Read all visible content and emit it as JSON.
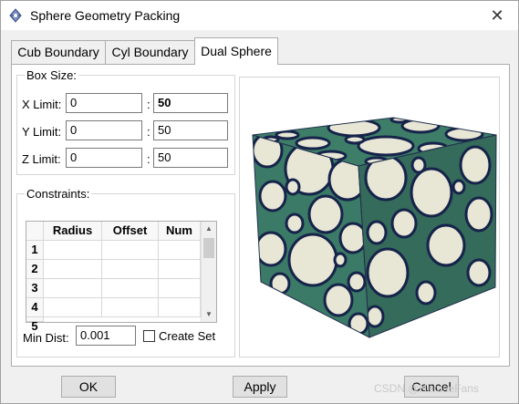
{
  "window": {
    "title": "Sphere Geometry Packing",
    "close_glyph": "✕"
  },
  "tabs": [
    {
      "label": "Cub Boundary",
      "active": false
    },
    {
      "label": "Cyl Boundary",
      "active": false
    },
    {
      "label": "Dual Sphere",
      "active": true
    }
  ],
  "box_size": {
    "legend": "Box Size:",
    "rows": [
      {
        "label": "X Limit:",
        "min": "0",
        "max": "50"
      },
      {
        "label": "Y Limit:",
        "min": "0",
        "max": "50"
      },
      {
        "label": "Z Limit:",
        "min": "0",
        "max": "50"
      }
    ],
    "separator": ":"
  },
  "constraints": {
    "legend": "Constraints:",
    "columns": [
      "Radius",
      "Offset",
      "Num"
    ],
    "row_numbers": [
      "1",
      "2",
      "3",
      "4",
      "5"
    ]
  },
  "min_dist": {
    "label": "Min Dist:",
    "value": "0.001"
  },
  "create_set": {
    "label": "Create Set",
    "checked": false
  },
  "buttons": {
    "ok": "OK",
    "apply": "Apply",
    "cancel": "Cancel"
  },
  "watermark": "CSDN @HeroseFans",
  "colors": {
    "cube_green": "#3b7a66",
    "sphere_fill": "#e8e6d5",
    "sphere_outline": "#16234a"
  }
}
